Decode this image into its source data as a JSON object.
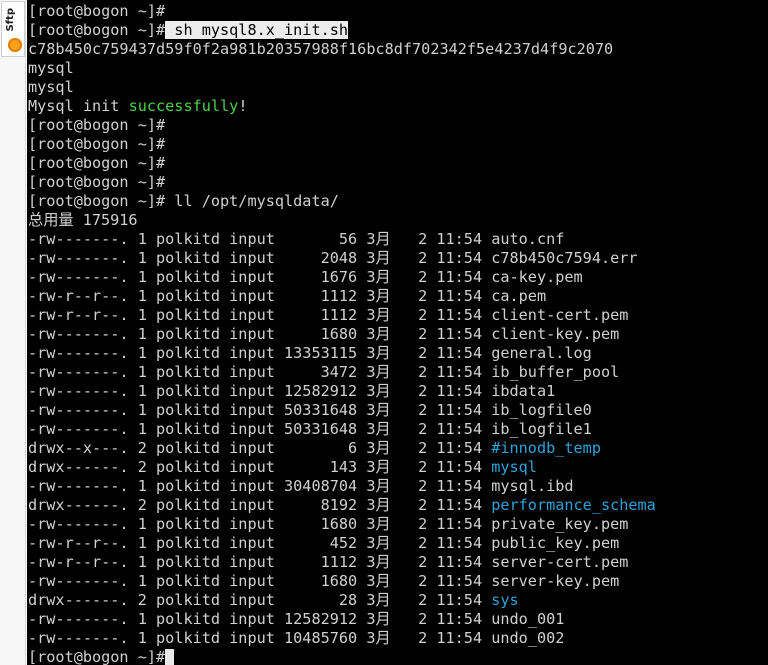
{
  "sidebar": {
    "sftp_label": "Sftp",
    "icon": "sftp-badge-icon"
  },
  "terminal": {
    "prompt": "[root@bogon ~]#",
    "command1": " sh mysql8.x_init.sh",
    "hash": "c78b450c759437d59f0f2a981b20357988f16bc8df702342f5e4237d4f9c2070",
    "out1": "mysql",
    "out2": "mysql",
    "init_prefix": "Mysql init ",
    "init_success": "successfully",
    "init_suffix": "!",
    "command2": " ll /opt/mysqldata/",
    "total": "总用量 175916",
    "files": [
      {
        "meta": "-rw-------. 1 polkitd input       56 3月   2 11:54 ",
        "name": "auto.cnf",
        "dir": false
      },
      {
        "meta": "-rw-------. 1 polkitd input     2048 3月   2 11:54 ",
        "name": "c78b450c7594.err",
        "dir": false
      },
      {
        "meta": "-rw-------. 1 polkitd input     1676 3月   2 11:54 ",
        "name": "ca-key.pem",
        "dir": false
      },
      {
        "meta": "-rw-r--r--. 1 polkitd input     1112 3月   2 11:54 ",
        "name": "ca.pem",
        "dir": false
      },
      {
        "meta": "-rw-r--r--. 1 polkitd input     1112 3月   2 11:54 ",
        "name": "client-cert.pem",
        "dir": false
      },
      {
        "meta": "-rw-------. 1 polkitd input     1680 3月   2 11:54 ",
        "name": "client-key.pem",
        "dir": false
      },
      {
        "meta": "-rw-------. 1 polkitd input 13353115 3月   2 11:54 ",
        "name": "general.log",
        "dir": false
      },
      {
        "meta": "-rw-------. 1 polkitd input     3472 3月   2 11:54 ",
        "name": "ib_buffer_pool",
        "dir": false
      },
      {
        "meta": "-rw-------. 1 polkitd input 12582912 3月   2 11:54 ",
        "name": "ibdata1",
        "dir": false
      },
      {
        "meta": "-rw-------. 1 polkitd input 50331648 3月   2 11:54 ",
        "name": "ib_logfile0",
        "dir": false
      },
      {
        "meta": "-rw-------. 1 polkitd input 50331648 3月   2 11:54 ",
        "name": "ib_logfile1",
        "dir": false
      },
      {
        "meta": "drwx--x---. 2 polkitd input        6 3月   2 11:54 ",
        "name": "#innodb_temp",
        "dir": true
      },
      {
        "meta": "drwx------. 2 polkitd input      143 3月   2 11:54 ",
        "name": "mysql",
        "dir": true
      },
      {
        "meta": "-rw-------. 1 polkitd input 30408704 3月   2 11:54 ",
        "name": "mysql.ibd",
        "dir": false
      },
      {
        "meta": "drwx------. 2 polkitd input     8192 3月   2 11:54 ",
        "name": "performance_schema",
        "dir": true
      },
      {
        "meta": "-rw-------. 1 polkitd input     1680 3月   2 11:54 ",
        "name": "private_key.pem",
        "dir": false
      },
      {
        "meta": "-rw-r--r--. 1 polkitd input      452 3月   2 11:54 ",
        "name": "public_key.pem",
        "dir": false
      },
      {
        "meta": "-rw-r--r--. 1 polkitd input     1112 3月   2 11:54 ",
        "name": "server-cert.pem",
        "dir": false
      },
      {
        "meta": "-rw-------. 1 polkitd input     1680 3月   2 11:54 ",
        "name": "server-key.pem",
        "dir": false
      },
      {
        "meta": "drwx------. 2 polkitd input       28 3月   2 11:54 ",
        "name": "sys",
        "dir": true
      },
      {
        "meta": "-rw-------. 1 polkitd input 12582912 3月   2 11:54 ",
        "name": "undo_001",
        "dir": false
      },
      {
        "meta": "-rw-------. 1 polkitd input 10485760 3月   2 11:54 ",
        "name": "undo_002",
        "dir": false
      }
    ]
  },
  "colors": {
    "background": "#000000",
    "text": "#d0d0d0",
    "success": "#4ad24a",
    "directory": "#2ba3d8"
  }
}
